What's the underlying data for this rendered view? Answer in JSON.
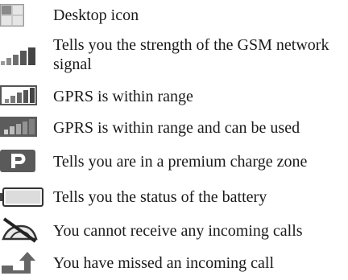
{
  "legend": {
    "rows": [
      {
        "icon": "desktop-icon",
        "desc": "Desktop icon"
      },
      {
        "icon": "signal-strength-icon",
        "desc_line1": "Tells you the strength of the GSM network",
        "desc_line2": "signal"
      },
      {
        "icon": "gprs-in-range-icon",
        "desc": "GPRS is within range"
      },
      {
        "icon": "gprs-in-use-icon",
        "desc": "GPRS is within range and can be used"
      },
      {
        "icon": "premium-zone-icon",
        "desc": "Tells you are in a premium charge zone"
      },
      {
        "icon": "battery-icon",
        "desc": "Tells you the status of the battery"
      },
      {
        "icon": "no-incoming-calls-icon",
        "desc": "You cannot receive any incoming calls"
      },
      {
        "icon": "missed-call-icon",
        "desc": "You have missed an incoming call"
      }
    ]
  }
}
